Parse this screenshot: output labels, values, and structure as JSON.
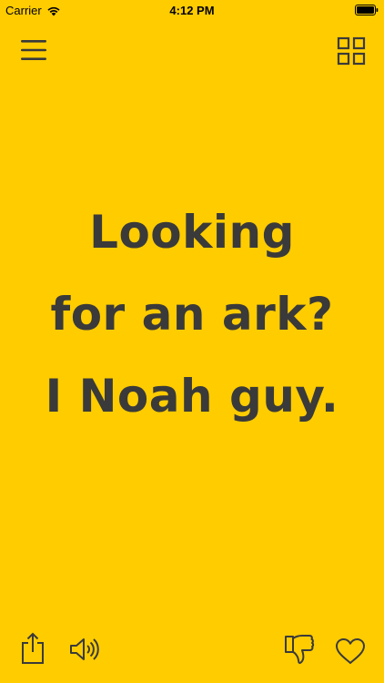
{
  "status_bar": {
    "carrier": "Carrier",
    "time": "4:12 PM"
  },
  "toolbar": {
    "menu_icon": "hamburger-menu-icon",
    "grid_icon": "grid-icon"
  },
  "joke": {
    "lines": [
      "Looking",
      "for an ark?",
      "I Noah guy."
    ]
  },
  "bottom_bar": {
    "share_icon": "share-icon",
    "sound_icon": "speaker-icon",
    "dislike_icon": "thumbs-down-icon",
    "like_icon": "heart-icon"
  },
  "colors": {
    "background": "#FFCC00",
    "text": "#3A3A3A"
  }
}
